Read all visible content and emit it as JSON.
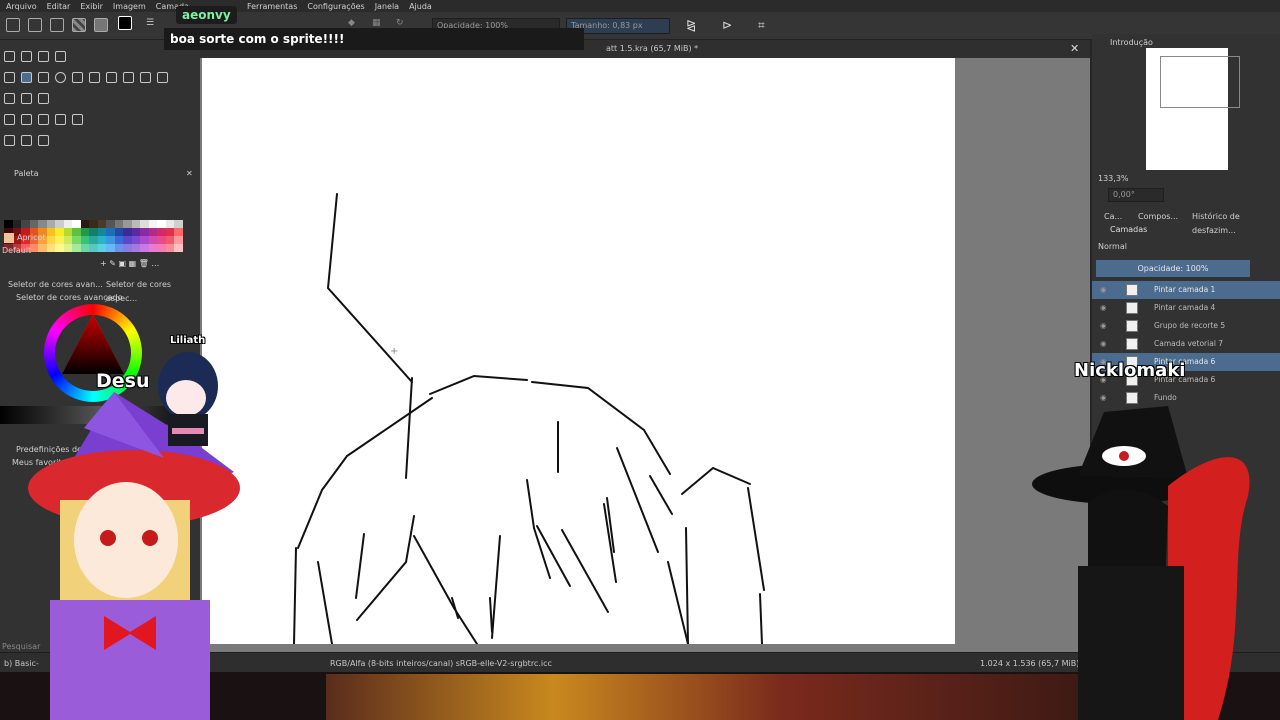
{
  "menu": [
    "Arquivo",
    "Editar",
    "Exibir",
    "Imagem",
    "Camada",
    "Ferramentas",
    "Configurações",
    "Janela",
    "Ajuda"
  ],
  "toolbar": {
    "opacity_label": "Opacidade: 100%",
    "size_label": "Tamanho: 0,83 px"
  },
  "document": {
    "tab_title": "att 1.5.kra (65,7 MiB) *",
    "close_glyph": "✕"
  },
  "left_dock": {
    "palette_title": "Paleta",
    "color_name": "Apricot",
    "palette_default": "Default",
    "adv_selector_tab": "Seletor de cores avan...",
    "spec_selector_tab": "Seletor de cores espec...",
    "adv_selector_title": "Seletor de cores avançado",
    "brush_presets_title": "Predefinições de p",
    "favorites_label": "Meus favoritos",
    "search_label": "Pesquisar",
    "preset_name": "b) Basic-"
  },
  "right_dock": {
    "overview_title": "Introdução",
    "zoom": "133,3%",
    "rotation": "0,00°",
    "tabs": [
      "Ca...",
      "Compos...",
      "Histórico de desfazim..."
    ],
    "layers_title": "Camadas",
    "blend_mode": "Normal",
    "opacity": "Opacidade:  100%",
    "layers": [
      {
        "name": "Pintar camada 1",
        "selected": true
      },
      {
        "name": "Pintar camada 4",
        "selected": false
      },
      {
        "name": "Grupo de recorte 5",
        "selected": false
      },
      {
        "name": "Camada vetorial 7",
        "selected": false
      },
      {
        "name": "Pintar camada 6",
        "selected": true
      },
      {
        "name": "Pintar camada 6",
        "selected": false
      },
      {
        "name": "Fundo",
        "selected": false
      }
    ]
  },
  "status": {
    "color_profile": "RGB/Alfa (8-bits inteiros/canal)  sRGB-elle-V2-srgbtrc.icc",
    "dimensions": "1.024 x 1.536 (65,7 MiB)"
  },
  "stream": {
    "chat_user": "aeonvy",
    "chat_message": "boa sorte com o sprite!!!!",
    "avatar_small_name": "Liliath",
    "avatar_small_tag": "Desu",
    "avatar_right_name": "Nicklomaki"
  },
  "colors": {
    "accent": "#4b6c8f",
    "fg_swatch": "#f2c29b"
  }
}
